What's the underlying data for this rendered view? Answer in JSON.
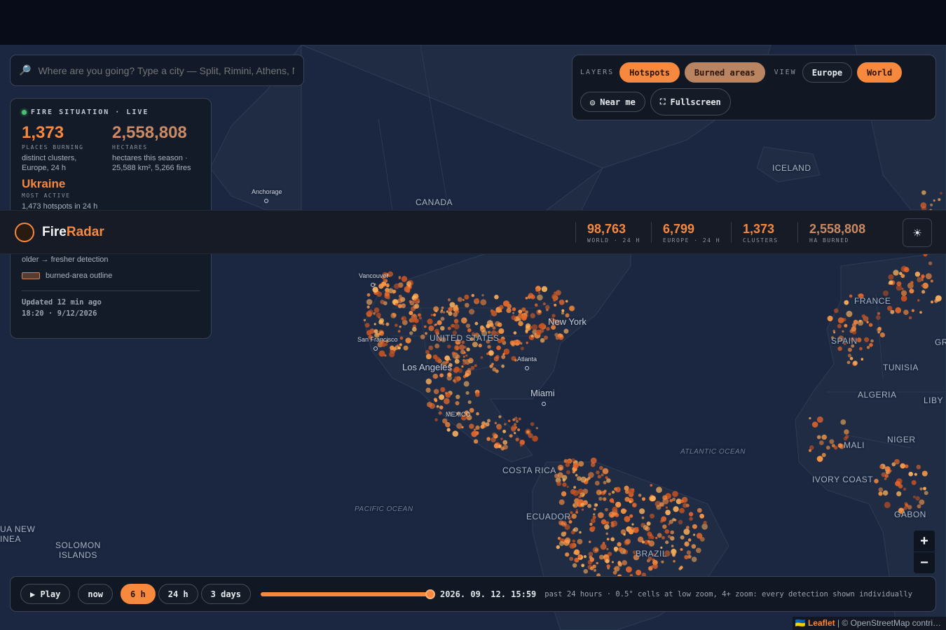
{
  "search": {
    "placeholder": "Where are you going? Type a city — Split, Rimini, Athens, Nice…",
    "icon": "magnifier-icon"
  },
  "layers": {
    "layers_label": "LAYERS",
    "hotspots": "Hotspots",
    "burned_areas": "Burned areas",
    "view_label": "VIEW",
    "europe": "Europe",
    "world": "World",
    "near_me": "Near me",
    "fullscreen": "Fullscreen"
  },
  "situation": {
    "title": "FIRE SITUATION · LIVE",
    "places_value": "1,373",
    "places_label": "PLACES BURNING",
    "places_sub": "distinct clusters, Europe, 24 h",
    "hectares_value": "2,558,808",
    "hectares_label": "HECTARES",
    "hectares_sub": "hectares this season · 25,588 km², 5,266 fires",
    "country": "Ukraine",
    "country_label": "MOST ACTIVE",
    "country_sub": "1,473 hotspots in 24 h",
    "legend_age": "older → fresher detection",
    "legend_burned": "burned-area outline",
    "updated": "Updated 12 min ago",
    "updated_ts": "18:20 · 9/12/2026"
  },
  "header": {
    "brand_a": "Fire",
    "brand_b": "Radar",
    "stats": [
      {
        "value": "98,763",
        "label": "WORLD · 24 H"
      },
      {
        "value": "6,799",
        "label": "EUROPE · 24 H"
      },
      {
        "value": "1,373",
        "label": "CLUSTERS"
      },
      {
        "value": "2,558,808",
        "label": "HA BURNED"
      }
    ],
    "theme_icon": "☀"
  },
  "map": {
    "places": {
      "iceland": "ICELAND",
      "canada": "CANADA",
      "anchorage": "Anchorage",
      "vancouver": "Vancouver",
      "sf": "San Francisco",
      "la": "Los Angeles",
      "us": "UNITED STATES",
      "ny": "New York",
      "atlanta": "Atlanta",
      "miami": "Miami",
      "mexico": "MEXICO",
      "costa_rica": "COSTA RICA",
      "ecuador": "ECUADOR",
      "brazil": "BRAZIL",
      "france": "FRANCE",
      "spain": "SPAIN",
      "tunisia": "TUNISIA",
      "algeria": "ALGERIA",
      "libya": "LIBY",
      "greece": "GR",
      "mali": "MALI",
      "niger": "NIGER",
      "ivory": "IVORY COAST",
      "gabon": "GABON",
      "atlantic": "ATLANTIC OCEAN",
      "pacific": "PACIFIC OCEAN",
      "solomon": "SOLOMON\nISLANDS",
      "png": "UA NEW\nINEA"
    },
    "zoom_in": "+",
    "zoom_out": "−"
  },
  "timeline": {
    "play": "▶ Play",
    "now": "now",
    "h6": "6 h",
    "h24": "24 h",
    "d3": "3 days",
    "slider_fraction": 1.0,
    "timestamp": "2026. 09. 12. 15:59",
    "note": "past 24 hours · 0.5° cells at low zoom, 4+ zoom: every detection shown individually"
  },
  "attribution": {
    "flag": "🇺🇦",
    "leaflet": "Leaflet",
    "rest": " | © OpenStreetMap contri…"
  },
  "colors": {
    "accent": "#f7893f",
    "burned": "#b98462",
    "live": "#47c06f"
  }
}
